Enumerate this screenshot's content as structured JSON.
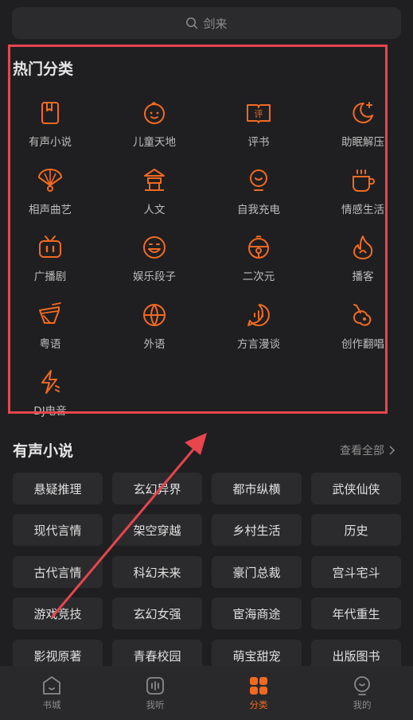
{
  "search": {
    "text": "剑来"
  },
  "hot": {
    "title": "热门分类",
    "items": [
      {
        "label": "有声小说",
        "icon": "book-icon"
      },
      {
        "label": "儿童天地",
        "icon": "baby-face-icon"
      },
      {
        "label": "评书",
        "icon": "open-book-ping-icon"
      },
      {
        "label": "助眠解压",
        "icon": "moon-star-icon"
      },
      {
        "label": "相声曲艺",
        "icon": "fan-icon"
      },
      {
        "label": "人文",
        "icon": "pavilion-icon"
      },
      {
        "label": "自我充电",
        "icon": "lightbulb-icon"
      },
      {
        "label": "情感生活",
        "icon": "coffee-cup-icon"
      },
      {
        "label": "广播剧",
        "icon": "radio-tv-icon"
      },
      {
        "label": "娱乐段子",
        "icon": "smile-face-icon"
      },
      {
        "label": "二次元",
        "icon": "bell-ball-icon"
      },
      {
        "label": "播客",
        "icon": "flame-icon"
      },
      {
        "label": "粤语",
        "icon": "drum-icon"
      },
      {
        "label": "外语",
        "icon": "globe-icon"
      },
      {
        "label": "方言漫谈",
        "icon": "voice-chat-icon"
      },
      {
        "label": "创作翻唱",
        "icon": "guitar-icon"
      },
      {
        "label": "DJ电音",
        "icon": "lightning-icon"
      }
    ]
  },
  "novels": {
    "title": "有声小说",
    "more": "查看全部",
    "chips": [
      "悬疑推理",
      "玄幻异界",
      "都市纵横",
      "武侠仙侠",
      "现代言情",
      "架空穿越",
      "乡村生活",
      "历史",
      "古代言情",
      "科幻未来",
      "豪门总裁",
      "宫斗宅斗",
      "游戏竞技",
      "玄幻女强",
      "宦海商途",
      "年代重生",
      "影视原著",
      "青春校园",
      "萌宝甜宠",
      "出版图书"
    ]
  },
  "tabs": [
    {
      "label": "书城",
      "icon": "house-icon",
      "active": false
    },
    {
      "label": "我听",
      "icon": "listen-icon",
      "active": false
    },
    {
      "label": "分类",
      "icon": "grid-icon",
      "active": true
    },
    {
      "label": "我的",
      "icon": "profile-icon",
      "active": false
    }
  ],
  "colors": {
    "accent": "#f26a21",
    "annotation": "#e8454d",
    "background": "#1f1f21"
  }
}
